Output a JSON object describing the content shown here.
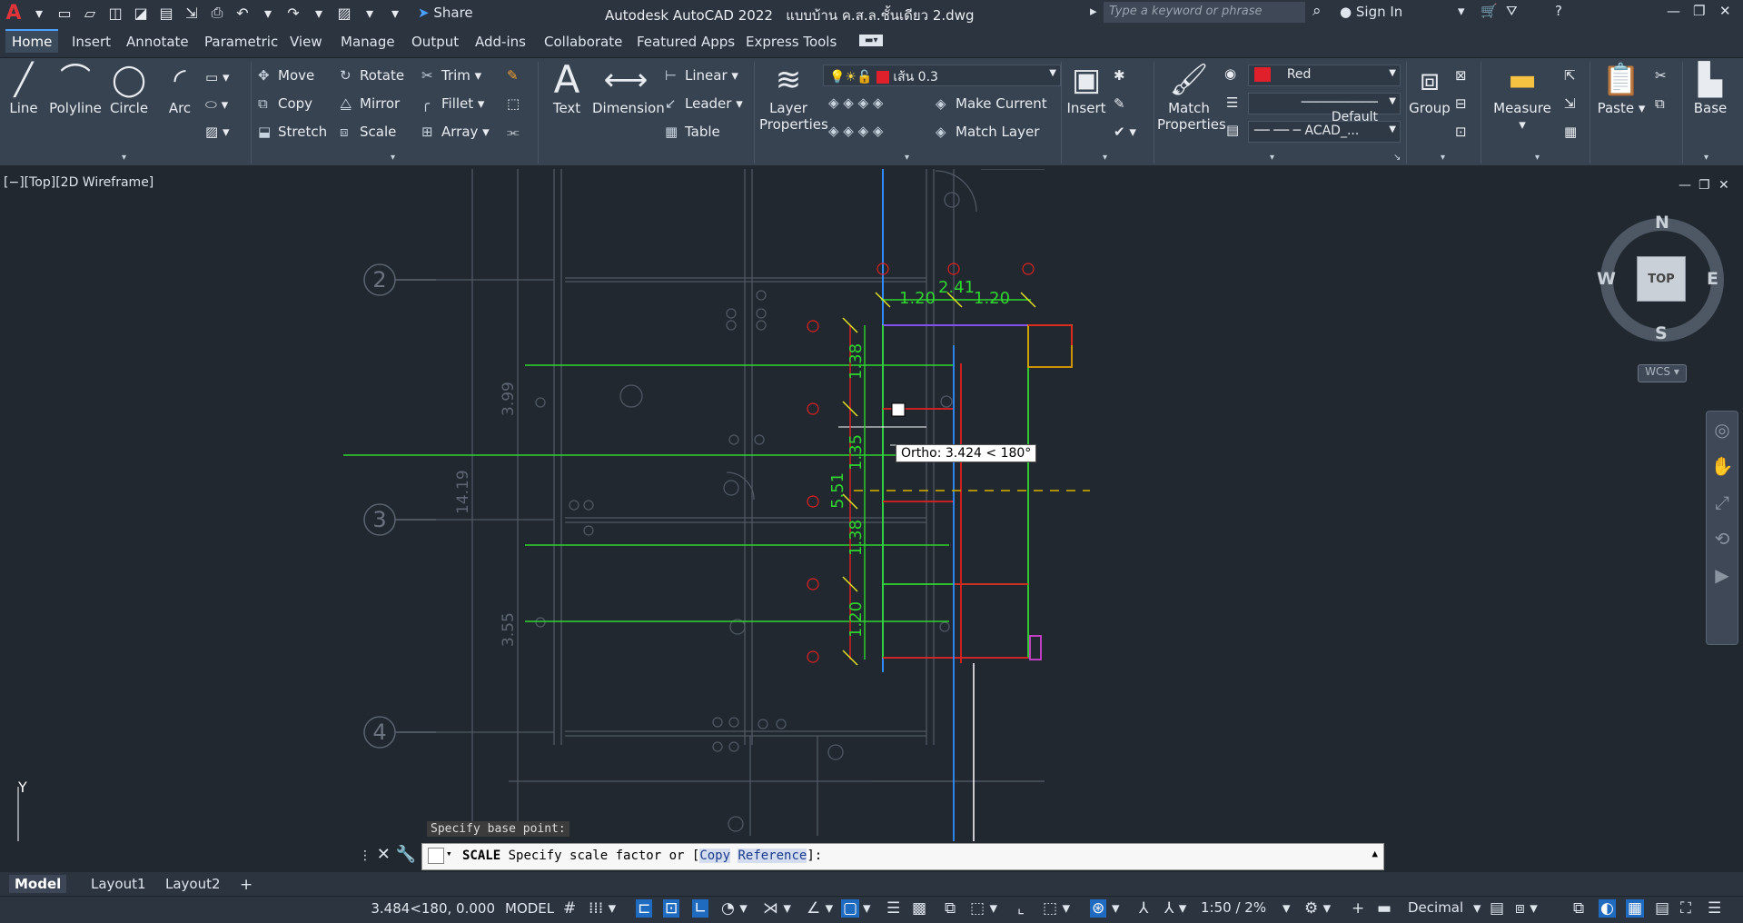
{
  "titlebar": {
    "app_title": "Autodesk AutoCAD 2022",
    "file_name": "แบบบ้าน ค.ส.ล.ชั้นเดียว 2.dwg",
    "share_label": "Share",
    "search_placeholder": "Type a keyword or phrase",
    "sign_in_label": "Sign In"
  },
  "tabs": [
    "Home",
    "Insert",
    "Annotate",
    "Parametric",
    "View",
    "Manage",
    "Output",
    "Add-ins",
    "Collaborate",
    "Featured Apps",
    "Express Tools"
  ],
  "ribbon": {
    "line": "Line",
    "polyline": "Polyline",
    "circle": "Circle",
    "arc": "Arc",
    "move": "Move",
    "rotate": "Rotate",
    "trim": "Trim",
    "copy": "Copy",
    "mirror": "Mirror",
    "fillet": "Fillet",
    "stretch": "Stretch",
    "scale": "Scale",
    "array": "Array",
    "text": "Text",
    "dimension": "Dimension",
    "linear": "Linear",
    "leader": "Leader",
    "table": "Table",
    "layer_properties": [
      "Layer",
      "Properties"
    ],
    "current_layer": "เส้น 0.3",
    "make_current": "Make Current",
    "match_layer": "Match Layer",
    "insert": "Insert",
    "match_properties": [
      "Match",
      "Properties"
    ],
    "color_value": "Red",
    "lineweight_value": "Default",
    "linetype_value": "ACAD_...",
    "group": "Group",
    "measure": "Measure",
    "paste": "Paste",
    "base": "Base"
  },
  "viewport": {
    "label": "[−][Top][2D Wireframe]",
    "tooltip": "Ortho: 3.424 < 180°",
    "prompt": "Specify base point:",
    "dims": {
      "top_left": "1.20",
      "top_mid": "2.41",
      "top_right": "1.20",
      "v1": "1.38",
      "v2": "1.35",
      "v3": "1.38",
      "v4": "1.20",
      "total": "5.51",
      "left_total": "14.19",
      "s1": "3.99",
      "s2": "3.55"
    },
    "grid_labels": [
      "2",
      "3",
      "4"
    ]
  },
  "navcube": {
    "top": "TOP",
    "n": "N",
    "s": "S",
    "e": "E",
    "w": "W",
    "wcs": "WCS"
  },
  "command": {
    "name": "SCALE",
    "text": "Specify scale factor or [",
    "opt1": "Copy",
    "opt2": "Reference",
    "end": "]:"
  },
  "layouts": [
    "Model",
    "Layout1",
    "Layout2"
  ],
  "status": {
    "coords": "3.484<180, 0.000",
    "model": "MODEL",
    "scale": "1:50 / 2%",
    "units": "Decimal"
  }
}
